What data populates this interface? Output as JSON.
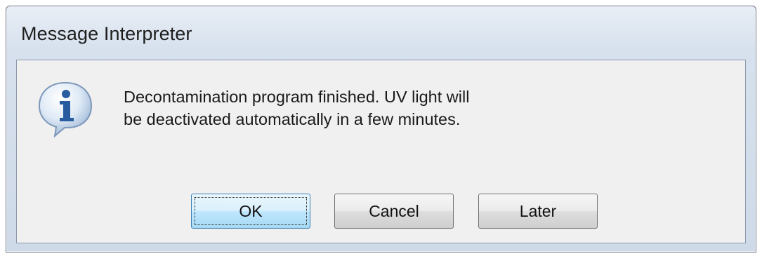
{
  "window": {
    "title": "Message Interpreter"
  },
  "icon": {
    "name": "information-icon",
    "glyph": "i",
    "color": "#2a5d9f"
  },
  "message": {
    "line1": "Decontamination program finished. UV light will",
    "line2": "be deactivated automatically in a few minutes."
  },
  "buttons": {
    "ok_label": "OK",
    "cancel_label": "Cancel",
    "later_label": "Later"
  }
}
